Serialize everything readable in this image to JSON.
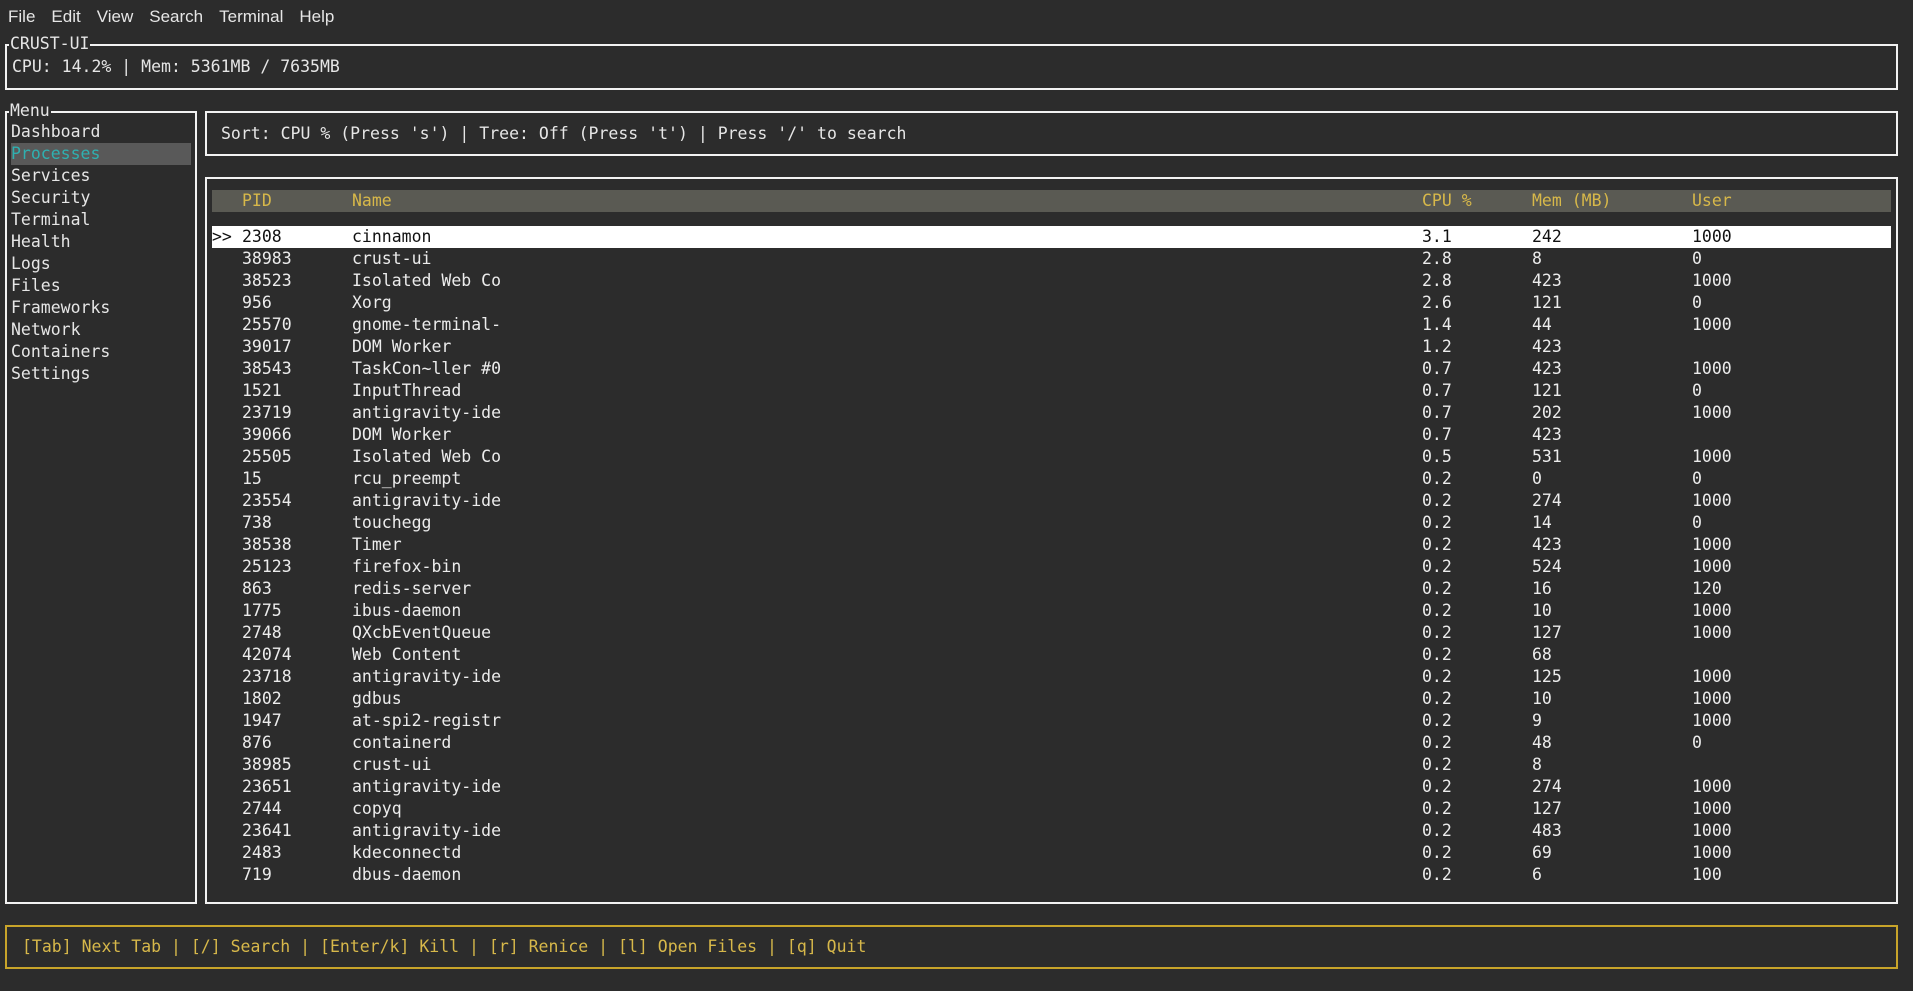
{
  "menubar": [
    "File",
    "Edit",
    "View",
    "Search",
    "Terminal",
    "Help"
  ],
  "header": {
    "title": "CRUST-UI",
    "stats": "CPU: 14.2% | Mem: 5361MB / 7635MB"
  },
  "sidebar": {
    "title": "Menu",
    "items": [
      "Dashboard",
      "Processes",
      "Services",
      "Security",
      "Terminal",
      "Health",
      "Logs",
      "Files",
      "Frameworks",
      "Network",
      "Containers",
      "Settings"
    ],
    "active_index": 1
  },
  "sortbar": {
    "text": "Sort: CPU % (Press 's') | Tree: Off (Press 't') | Press '/' to search"
  },
  "table": {
    "columns": [
      "PID",
      "Name",
      "CPU %",
      "Mem (MB)",
      "User"
    ],
    "selected_marker": ">>",
    "selected_index": 0,
    "rows": [
      [
        "2308",
        "cinnamon",
        "3.1",
        "242",
        "1000"
      ],
      [
        "38983",
        "crust-ui",
        "2.8",
        "8",
        "0"
      ],
      [
        "38523",
        "Isolated Web Co",
        "2.8",
        "423",
        "1000"
      ],
      [
        "956",
        "Xorg",
        "2.6",
        "121",
        "0"
      ],
      [
        "25570",
        "gnome-terminal-",
        "1.4",
        "44",
        "1000"
      ],
      [
        "39017",
        "DOM Worker",
        "1.2",
        "423",
        ""
      ],
      [
        "38543",
        "TaskCon~ller #0",
        "0.7",
        "423",
        "1000"
      ],
      [
        "1521",
        "InputThread",
        "0.7",
        "121",
        "0"
      ],
      [
        "23719",
        "antigravity-ide",
        "0.7",
        "202",
        "1000"
      ],
      [
        "39066",
        "DOM Worker",
        "0.7",
        "423",
        ""
      ],
      [
        "25505",
        "Isolated Web Co",
        "0.5",
        "531",
        "1000"
      ],
      [
        "15",
        "rcu_preempt",
        "0.2",
        "0",
        "0"
      ],
      [
        "23554",
        "antigravity-ide",
        "0.2",
        "274",
        "1000"
      ],
      [
        "738",
        "touchegg",
        "0.2",
        "14",
        "0"
      ],
      [
        "38538",
        "Timer",
        "0.2",
        "423",
        "1000"
      ],
      [
        "25123",
        "firefox-bin",
        "0.2",
        "524",
        "1000"
      ],
      [
        "863",
        "redis-server",
        "0.2",
        "16",
        "120"
      ],
      [
        "1775",
        "ibus-daemon",
        "0.2",
        "10",
        "1000"
      ],
      [
        "2748",
        "QXcbEventQueue",
        "0.2",
        "127",
        "1000"
      ],
      [
        "42074",
        "Web Content",
        "0.2",
        "68",
        ""
      ],
      [
        "23718",
        "antigravity-ide",
        "0.2",
        "125",
        "1000"
      ],
      [
        "1802",
        "gdbus",
        "0.2",
        "10",
        "1000"
      ],
      [
        "1947",
        "at-spi2-registr",
        "0.2",
        "9",
        "1000"
      ],
      [
        "876",
        "containerd",
        "0.2",
        "48",
        "0"
      ],
      [
        "38985",
        "crust-ui",
        "0.2",
        "8",
        ""
      ],
      [
        "23651",
        "antigravity-ide",
        "0.2",
        "274",
        "1000"
      ],
      [
        "2744",
        "copyq",
        "0.2",
        "127",
        "1000"
      ],
      [
        "23641",
        "antigravity-ide",
        "0.2",
        "483",
        "1000"
      ],
      [
        "2483",
        "kdeconnectd",
        "0.2",
        "69",
        "1000"
      ],
      [
        "719",
        "dbus-daemon",
        "0.2",
        "6",
        "100"
      ]
    ]
  },
  "footer": {
    "keys": "[Tab] Next Tab | [/] Search | [Enter/k] Kill | [r] Renice | [l] Open Files | [q] Quit"
  },
  "colors": {
    "background": "#2c2c2c",
    "accent_yellow": "#d7b84a",
    "active_cyan": "#2fb0b0",
    "header_row_bg": "#5a5a53"
  }
}
